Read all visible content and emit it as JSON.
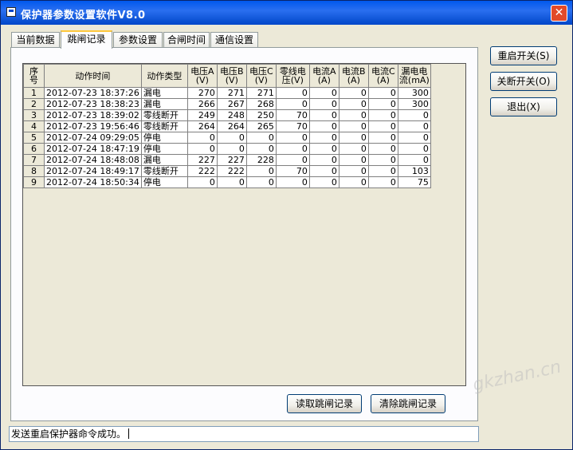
{
  "window": {
    "title": "保护器参数设置软件V8.0",
    "close_glyph": "✕"
  },
  "tabs": [
    {
      "label": "当前数据",
      "active": false
    },
    {
      "label": "跳闸记录",
      "active": true
    },
    {
      "label": "参数设置",
      "active": false
    },
    {
      "label": "合闸时间",
      "active": false
    },
    {
      "label": "通信设置",
      "active": false
    }
  ],
  "grid": {
    "headers": [
      {
        "l1": "序",
        "l2": "号"
      },
      {
        "l1": "动作时间",
        "l2": ""
      },
      {
        "l1": "动作类型",
        "l2": ""
      },
      {
        "l1": "电压A",
        "l2": "(V)"
      },
      {
        "l1": "电压B",
        "l2": "(V)"
      },
      {
        "l1": "电压C",
        "l2": "(V)"
      },
      {
        "l1": "零线电",
        "l2": "压(V)"
      },
      {
        "l1": "电流A",
        "l2": "(A)"
      },
      {
        "l1": "电流B",
        "l2": "(A)"
      },
      {
        "l1": "电流C",
        "l2": "(A)"
      },
      {
        "l1": "漏电电",
        "l2": "流(mA)"
      }
    ],
    "rows": [
      [
        "1",
        "2012-07-23  18:37:26",
        "漏电",
        "270",
        "271",
        "271",
        "0",
        "0",
        "0",
        "0",
        "300"
      ],
      [
        "2",
        "2012-07-23  18:38:23",
        "漏电",
        "266",
        "267",
        "268",
        "0",
        "0",
        "0",
        "0",
        "300"
      ],
      [
        "3",
        "2012-07-23  18:39:02",
        "零线断开",
        "249",
        "248",
        "250",
        "70",
        "0",
        "0",
        "0",
        "0"
      ],
      [
        "4",
        "2012-07-23  19:56:46",
        "零线断开",
        "264",
        "264",
        "265",
        "70",
        "0",
        "0",
        "0",
        "0"
      ],
      [
        "5",
        "2012-07-24  09:29:05",
        "停电",
        "0",
        "0",
        "0",
        "0",
        "0",
        "0",
        "0",
        "0"
      ],
      [
        "6",
        "2012-07-24  18:47:19",
        "停电",
        "0",
        "0",
        "0",
        "0",
        "0",
        "0",
        "0",
        "0"
      ],
      [
        "7",
        "2012-07-24  18:48:08",
        "漏电",
        "227",
        "227",
        "228",
        "0",
        "0",
        "0",
        "0",
        "0"
      ],
      [
        "8",
        "2012-07-24  18:49:17",
        "零线断开",
        "222",
        "222",
        "0",
        "70",
        "0",
        "0",
        "0",
        "103"
      ],
      [
        "9",
        "2012-07-24  18:50:34",
        "停电",
        "0",
        "0",
        "0",
        "0",
        "0",
        "0",
        "0",
        "75"
      ]
    ]
  },
  "buttons": {
    "read_records": "读取跳闸记录",
    "clear_records": "清除跳闸记录",
    "restart_switch": "重启开关(S)",
    "close_switch": "关断开关(O)",
    "exit": "退出(X)"
  },
  "status": {
    "message": "发送重启保护器命令成功。"
  }
}
